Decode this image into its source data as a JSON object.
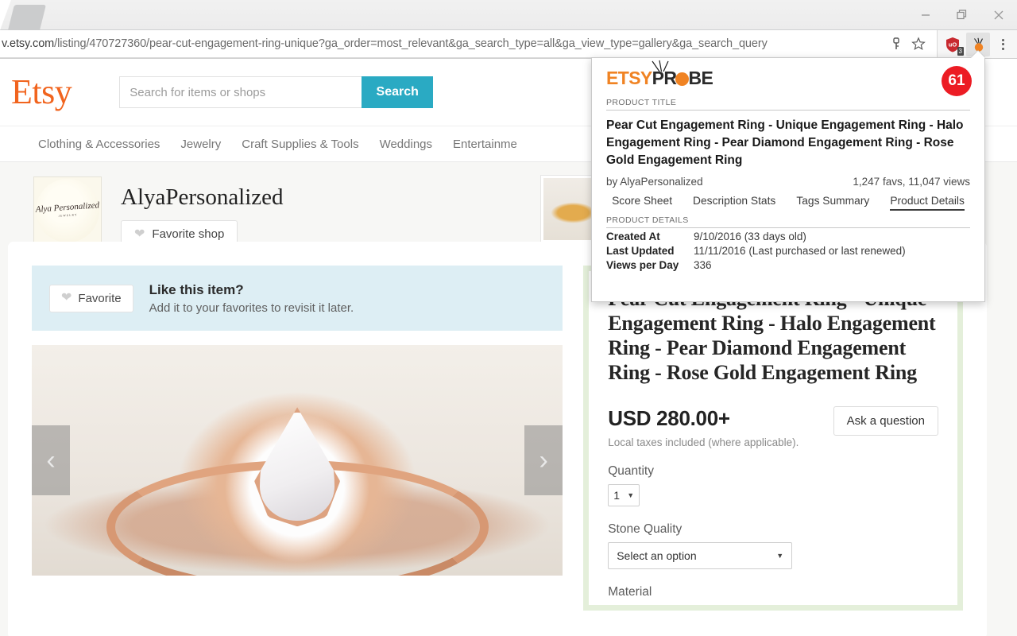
{
  "browser": {
    "url_prefix": "v.etsy.com",
    "url_rest": "/listing/470727360/pear-cut-engagement-ring-unique?ga_order=most_relevant&ga_search_type=all&ga_view_type=gallery&ga_search_query",
    "minimize_label": "—",
    "restore_label": "Restore",
    "close_label": "Close",
    "extension_badge_count": "3"
  },
  "etsy": {
    "logo": "Etsy",
    "search_placeholder": "Search for items or shops",
    "search_button": "Search",
    "nav": [
      "Clothing & Accessories",
      "Jewelry",
      "Craft Supplies & Tools",
      "Weddings",
      "Entertainme"
    ],
    "shop": {
      "name": "AlyaPersonalized",
      "avatar_text": "Alya Personalized",
      "avatar_sub": "JEWELRY",
      "favorite_shop_label": "Favorite shop"
    },
    "favorite_banner": {
      "button_label": "Favorite",
      "title": "Like this item?",
      "subtitle": "Add it to your favorites to revisit it later."
    },
    "gallery": {
      "prev_label": "‹",
      "next_label": "›"
    },
    "listing": {
      "title": "Pear Cut Engagement Ring - Unique Engagement Ring - Halo Engagement Ring - Pear Diamond Engagement Ring - Rose Gold Engagement Ring",
      "price": "USD 280.00+",
      "price_note": "Local taxes included (where applicable).",
      "ask_button": "Ask a question",
      "quantity_label": "Quantity",
      "quantity_value": "1",
      "stone_quality_label": "Stone Quality",
      "stone_quality_value": "Select an option",
      "material_label": "Material"
    }
  },
  "popup": {
    "brand_etsy": "ETSY",
    "brand_pr": "PR",
    "brand_be": "BE",
    "score": "61",
    "section_title_label": "PRODUCT TITLE",
    "product_title": "Pear Cut Engagement Ring - Unique Engagement Ring - Halo Engagement Ring - Pear Diamond Engagement Ring - Rose Gold Engagement Ring",
    "by_line": "by AlyaPersonalized",
    "stats": "1,247 favs, 11,047 views",
    "tabs": [
      {
        "label": "Score Sheet",
        "active": false
      },
      {
        "label": "Description Stats",
        "active": false
      },
      {
        "label": "Tags Summary",
        "active": false
      },
      {
        "label": "Product Details",
        "active": true
      }
    ],
    "details_label": "PRODUCT DETAILS",
    "details": [
      {
        "key": "Created At",
        "value": "9/10/2016 (33 days old)"
      },
      {
        "key": "Last Updated",
        "value": "11/11/2016 (Last purchased or last renewed)"
      },
      {
        "key": "Views per Day",
        "value": "336"
      }
    ]
  },
  "colors": {
    "etsy_orange": "#f1641e",
    "etsy_search_blue": "#2aaac3",
    "probe_orange": "#f08323",
    "badge_red": "#ec1c24",
    "panel_green": "#e4efda",
    "banner_blue": "#ddeef4"
  }
}
